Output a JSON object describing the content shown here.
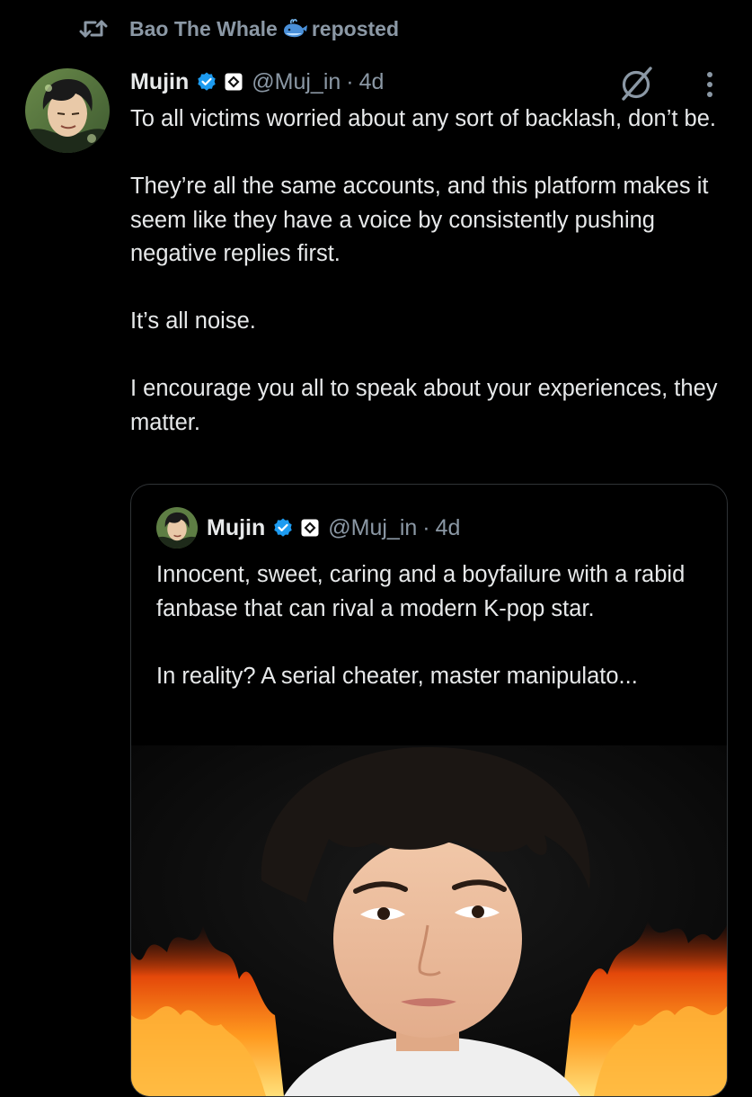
{
  "repost": {
    "user": "Bao The Whale",
    "emoji": "whale-emoji",
    "label": "reposted"
  },
  "tweet": {
    "author_name": "Mujin",
    "handle": "@Muj_in",
    "separator": "·",
    "time": "4d",
    "paragraphs": [
      "To all victims worried about any sort of backlash, don’t be.",
      "They’re all the same accounts, and this platform makes it seem like they have a voice by consistently pushing negative replies first.",
      "It’s all noise.",
      "I encourage you all to speak about your experiences, they matter."
    ]
  },
  "quote": {
    "author_name": "Mujin",
    "handle": "@Muj_in",
    "separator": "·",
    "time": "4d",
    "paragraphs": [
      "Innocent, sweet, caring and a boyfailure with a rabid fanbase that can rival a modern K-pop star.",
      "In reality? A serial cheater, master manipulato..."
    ]
  },
  "icons": {
    "repost": "repost-icon",
    "verified": "verified-badge-icon",
    "affiliate": "affiliate-badge-icon",
    "grok": "grok-icon",
    "more": "more-options-icon"
  },
  "colors": {
    "background": "#000000",
    "text_primary": "#e7e9ea",
    "text_secondary": "#8b98a5",
    "verified_blue": "#1d9bf0",
    "border": "#2f3336"
  }
}
